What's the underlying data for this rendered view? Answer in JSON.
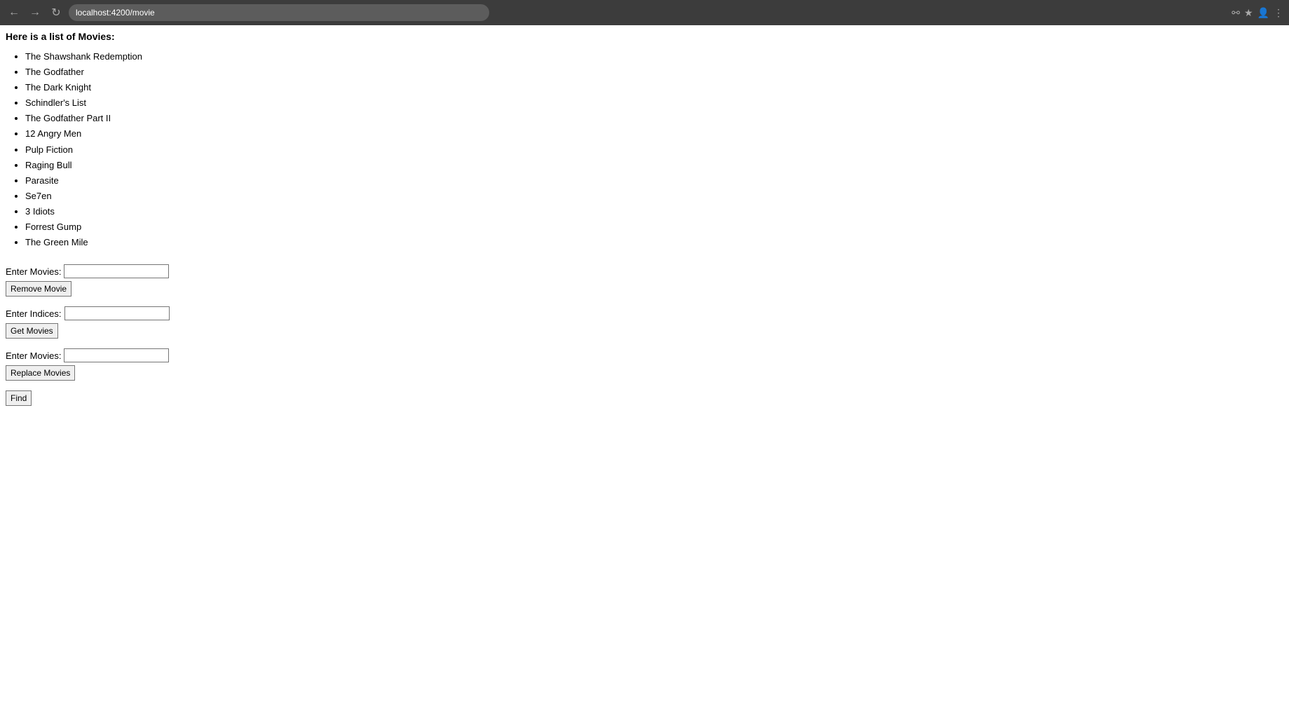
{
  "browser": {
    "url": "localhost:4200/movie",
    "back_label": "←",
    "forward_label": "→",
    "reload_label": "↻"
  },
  "page": {
    "title": "Here is a list of Movies:",
    "movies": [
      "The Shawshank Redemption",
      "The Godfather",
      "The Dark Knight",
      "Schindler's List",
      "The Godfather Part II",
      "12 Angry Men",
      "Pulp Fiction",
      "Raging Bull",
      "Parasite",
      "Se7en",
      "3 Idiots",
      "Forrest Gump",
      "The Green Mile"
    ]
  },
  "forms": {
    "remove": {
      "label": "Enter Movies:",
      "placeholder": "",
      "button_label": "Remove Movie"
    },
    "get": {
      "label": "Enter Indices:",
      "placeholder": "",
      "button_label": "Get Movies"
    },
    "replace": {
      "label": "Enter Movies:",
      "placeholder": "",
      "button_label": "Replace Movies"
    },
    "find": {
      "button_label": "Find"
    }
  }
}
